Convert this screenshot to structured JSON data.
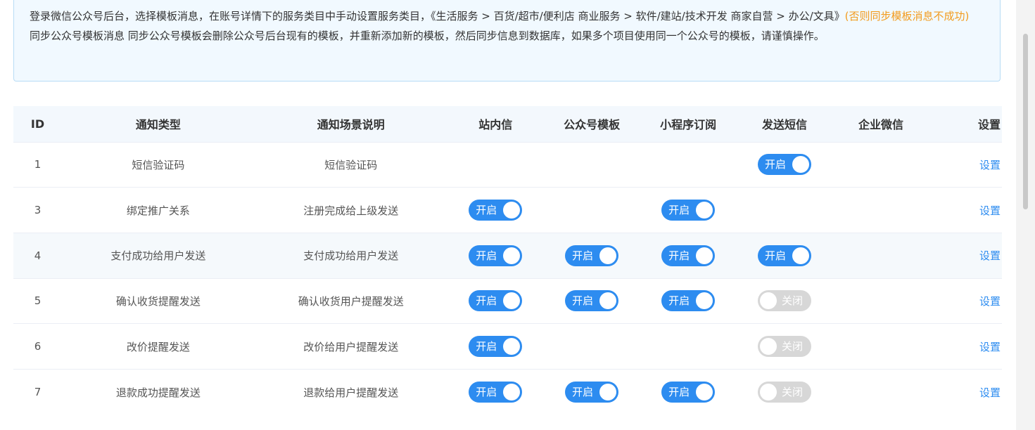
{
  "notice": {
    "line1": "登录微信公众号后台，选择模板消息，在账号详情下的服务类目中手动设置服务类目，《生活服务 > 百货/超市/便利店 商业服务 > 软件/建站/技术开发 商家自营 > 办公/文具》",
    "warning": "(否则同步模板消息不成功)",
    "line2": "同步公众号模板消息 同步公众号模板会删除公众号后台现有的模板，并重新添加新的模板，然后同步信息到数据库，如果多个项目使用同一个公众号的模板，请谨慎操作。"
  },
  "table": {
    "headers": [
      "ID",
      "通知类型",
      "通知场景说明",
      "站内信",
      "公众号模板",
      "小程序订阅",
      "发送短信",
      "企业微信",
      "设置"
    ],
    "switch_on_label": "开启",
    "switch_off_label": "关闭",
    "action_label": "设置",
    "rows": [
      {
        "id": "1",
        "type": "短信验证码",
        "desc": "短信验证码",
        "inbox": null,
        "mp": null,
        "mini": null,
        "sms": true,
        "wework": null
      },
      {
        "id": "3",
        "type": "绑定推广关系",
        "desc": "注册完成给上级发送",
        "inbox": true,
        "mp": null,
        "mini": true,
        "sms": null,
        "wework": null
      },
      {
        "id": "4",
        "type": "支付成功给用户发送",
        "desc": "支付成功给用户发送",
        "inbox": true,
        "mp": true,
        "mini": true,
        "sms": true,
        "wework": null
      },
      {
        "id": "5",
        "type": "确认收货提醒发送",
        "desc": "确认收货用户提醒发送",
        "inbox": true,
        "mp": true,
        "mini": true,
        "sms": false,
        "wework": null
      },
      {
        "id": "6",
        "type": "改价提醒发送",
        "desc": "改价给用户提醒发送",
        "inbox": true,
        "mp": null,
        "mini": null,
        "sms": false,
        "wework": null
      },
      {
        "id": "7",
        "type": "退款成功提醒发送",
        "desc": "退款给用户提醒发送",
        "inbox": true,
        "mp": true,
        "mini": true,
        "sms": false,
        "wework": null
      }
    ]
  },
  "colors": {
    "accent": "#2d8cf0",
    "warning": "#f29b1c",
    "switch_off": "#d7d7d7"
  }
}
